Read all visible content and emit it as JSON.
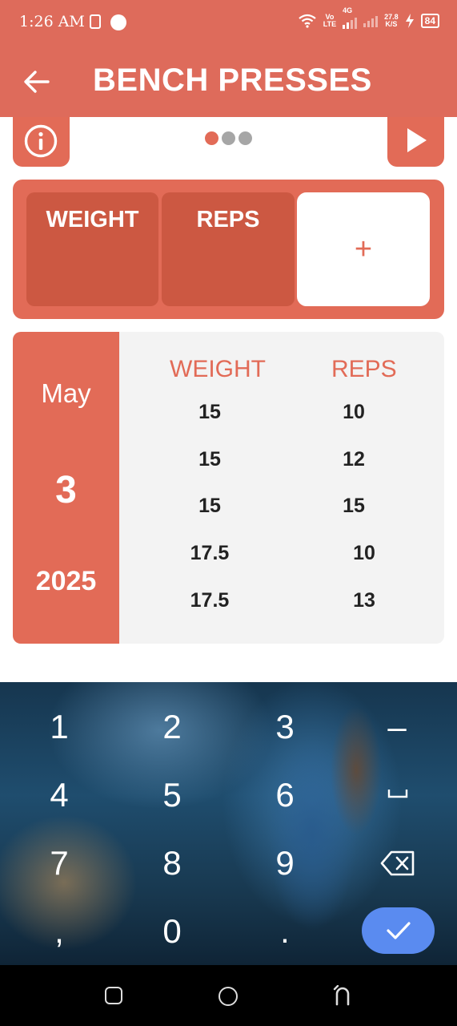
{
  "status_bar": {
    "time": "1:26 AM",
    "net_top": "Vo",
    "net_bottom": "LTE",
    "net_type": "4G",
    "speed_value": "27.8",
    "speed_unit": "K/S",
    "battery": "84",
    "icons": [
      "sim-icon",
      "notification-dot-icon",
      "wifi-icon",
      "signal-icon",
      "charging-icon",
      "battery-icon"
    ]
  },
  "app_bar": {
    "title": "BENCH PRESSES",
    "back_icon": "arrow-left-icon"
  },
  "toolbar": {
    "info_icon": "info-icon",
    "play_icon": "play-icon",
    "pages": 3,
    "active_page": 1
  },
  "input": {
    "weight_label": "WEIGHT",
    "reps_label": "REPS",
    "add_label": "+"
  },
  "history": {
    "month": "May",
    "day": "3",
    "year": "2025",
    "weight_header": "WEIGHT",
    "reps_header": "REPS",
    "rows": [
      {
        "weight": "15",
        "reps": "10"
      },
      {
        "weight": "15",
        "reps": "12"
      },
      {
        "weight": "15",
        "reps": "15"
      },
      {
        "weight": "17.5",
        "reps": "10"
      },
      {
        "weight": "17.5",
        "reps": "13"
      }
    ]
  },
  "keyboard": {
    "keys": [
      "1",
      "2",
      "3",
      "4",
      "5",
      "6",
      "7",
      "8",
      "9",
      ",",
      "0",
      "."
    ],
    "minus": "–",
    "space_icon": "space-icon",
    "backspace_icon": "backspace-icon",
    "done_icon": "checkmark-icon"
  },
  "nav_bar": {
    "recents_icon": "recents-square-icon",
    "home_icon": "home-circle-icon",
    "back_icon": "back-arch-icon"
  },
  "colors": {
    "primary": "#DE6B5B",
    "cell_dark": "#CC5842",
    "card_bg": "#F3F3F3",
    "done_button": "#5A8BF0"
  }
}
